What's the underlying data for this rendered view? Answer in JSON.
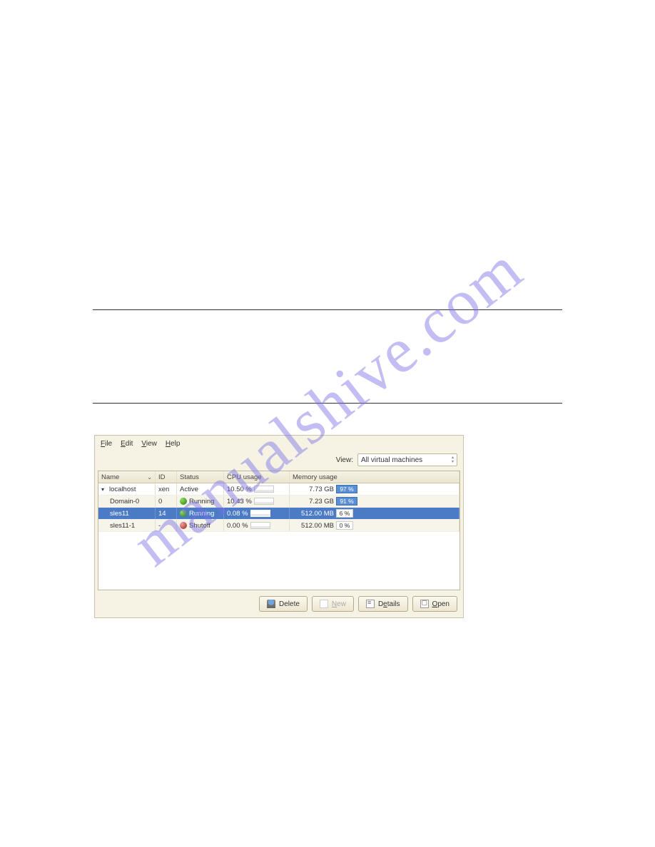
{
  "watermark": "manualshive.com",
  "menubar": {
    "file": "File",
    "edit": "Edit",
    "view": "View",
    "help": "Help"
  },
  "viewrow": {
    "label": "View:",
    "value": "All virtual machines"
  },
  "columns": {
    "name": "Name",
    "id": "ID",
    "status": "Status",
    "cpu": "CPU usage",
    "mem": "Memory usage"
  },
  "rows": [
    {
      "indent": 0,
      "expand": "▾",
      "name": "localhost",
      "id": "xen",
      "icon": "",
      "status": "Active",
      "cpu": "10.50 %",
      "mem": "7.73 GB",
      "mempct": "97 %",
      "bar": "big",
      "sel": false,
      "alt": false
    },
    {
      "indent": 1,
      "expand": "",
      "name": "Domain-0",
      "id": "0",
      "icon": "run",
      "status": "Running",
      "cpu": "10.43 %",
      "mem": "7.23 GB",
      "mempct": "91 %",
      "bar": "big",
      "sel": false,
      "alt": true
    },
    {
      "indent": 1,
      "expand": "",
      "name": "sles11",
      "id": "14",
      "icon": "run",
      "status": "Running",
      "cpu": "0.08 %",
      "mem": "512.00 MB",
      "mempct": "6 %",
      "bar": "small",
      "sel": true,
      "alt": false
    },
    {
      "indent": 1,
      "expand": "",
      "name": "sles11-1",
      "id": "-",
      "icon": "shut",
      "status": "Shutoff",
      "cpu": "0.00 %",
      "mem": "512.00 MB",
      "mempct": "0 %",
      "bar": "small",
      "sel": false,
      "alt": true
    }
  ],
  "buttons": {
    "delete": "Delete",
    "new": "New",
    "details": "Details",
    "open": "Open"
  }
}
